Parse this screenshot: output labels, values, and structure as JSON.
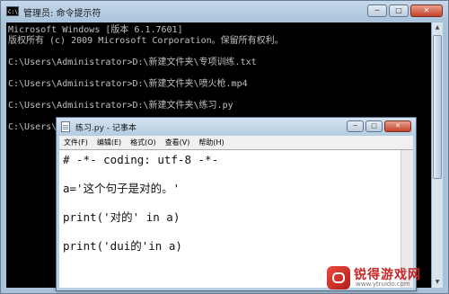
{
  "cmd": {
    "title": "管理员: 命令提示符",
    "lines": [
      "Microsoft Windows [版本 6.1.7601]",
      "版权所有 (c) 2009 Microsoft Corporation。保留所有权利。",
      "",
      "C:\\Users\\Administrator>D:\\新建文件夹\\专项训练.txt",
      "",
      "C:\\Users\\Administrator>D:\\新建文件夹\\喷火枪.mp4",
      "",
      "C:\\Users\\Administrator>D:\\新建文件夹\\练习.py",
      "",
      "C:\\Users\\"
    ],
    "buttons": {
      "minimize": "─",
      "maximize": "□",
      "close": "✕"
    }
  },
  "notepad": {
    "title": "练习.py - 记事本",
    "menu": [
      "文件(F)",
      "编辑(E)",
      "格式(O)",
      "查看(V)",
      "帮助(H)"
    ],
    "code": [
      "# -*- coding: utf-8 -*-",
      "a='这个句子是对的。'",
      "print('对的' in a)",
      "print('dui的'in a)"
    ],
    "buttons": {
      "minimize": "─",
      "maximize": "□",
      "close": "✕"
    }
  },
  "watermark": {
    "name": "锐得游戏网",
    "url": "www.ytruido.com"
  },
  "colors": {
    "console_bg": "#000000",
    "console_text": "#c0c0c0",
    "frame": "#a9c3d9",
    "close_red": "#c4432a"
  }
}
